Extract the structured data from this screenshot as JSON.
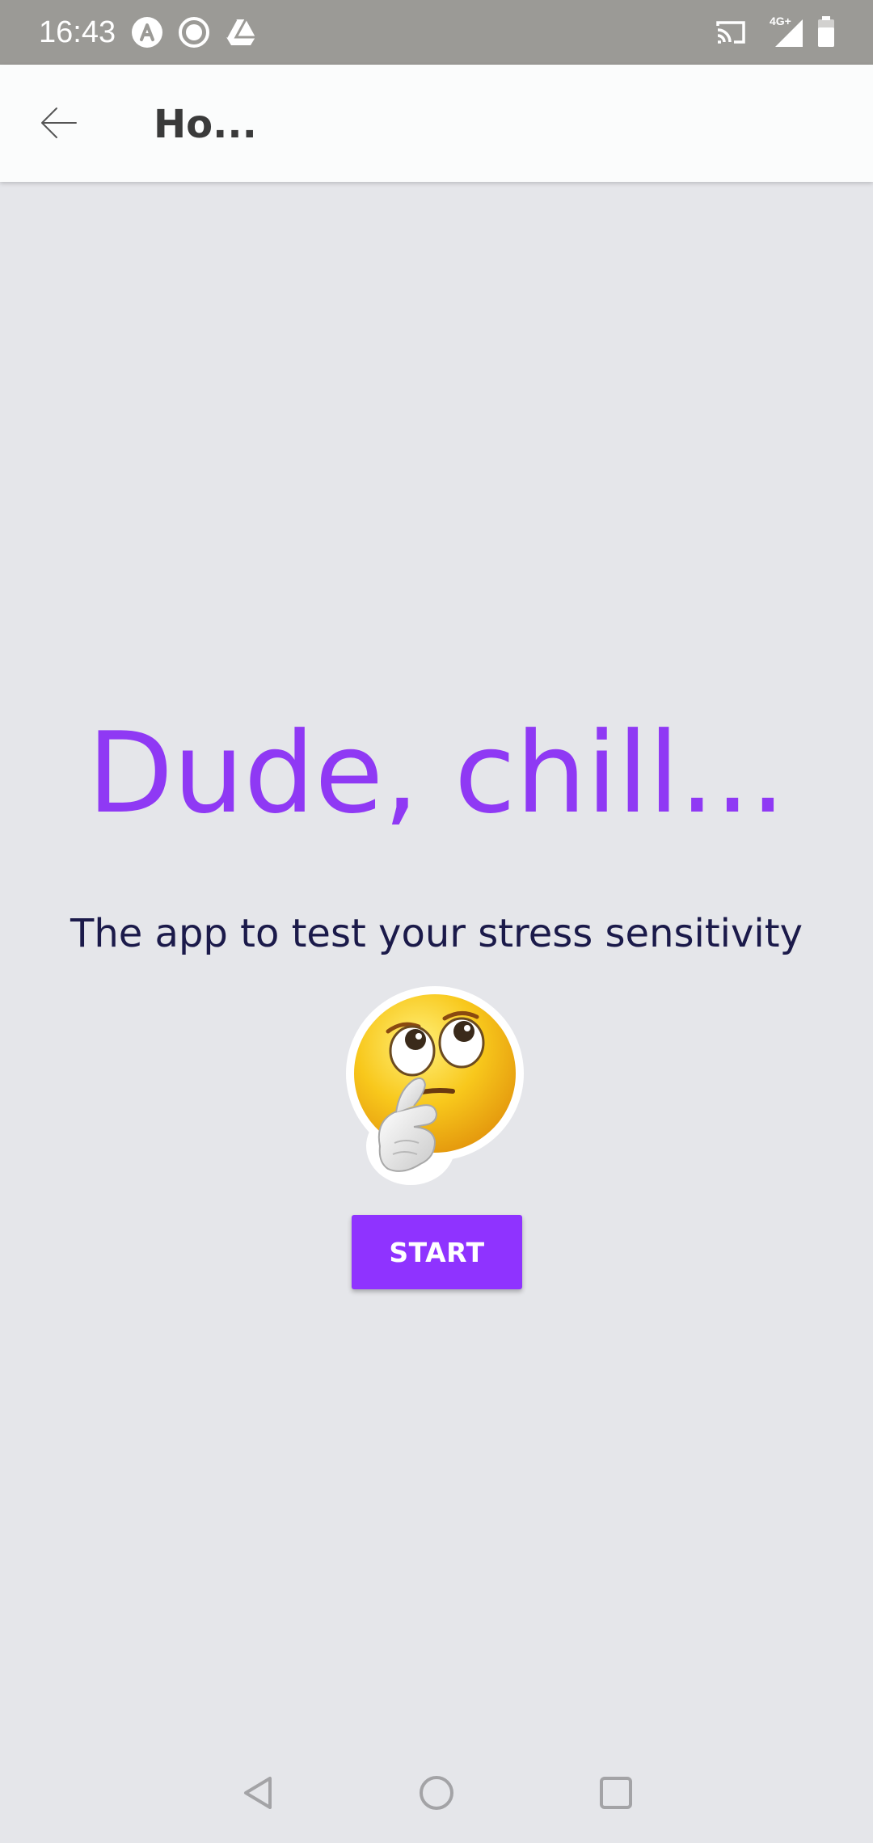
{
  "status_bar": {
    "time": "16:43",
    "left_icons": [
      "arc-logo-icon",
      "record-icon",
      "drive-icon"
    ],
    "network_label": "4G+",
    "right_icons": [
      "cast-icon",
      "signal-icon",
      "battery-icon"
    ]
  },
  "app_bar": {
    "title": "Ho...",
    "back_icon": "arrow-back-icon"
  },
  "main": {
    "headline": "Dude, chill...",
    "subtitle": "The app to test your stress sensitivity",
    "emoji": "thinking-face-icon",
    "start_label": "START"
  },
  "nav_bar": {
    "icons": [
      "nav-back-icon",
      "nav-home-icon",
      "nav-recents-icon"
    ]
  },
  "colors": {
    "accent": "#8f33ff",
    "headline": "#8f39f4",
    "subtitle": "#1b1a4a",
    "background": "#e5e6ea",
    "status_bar": "#9b9a96"
  }
}
